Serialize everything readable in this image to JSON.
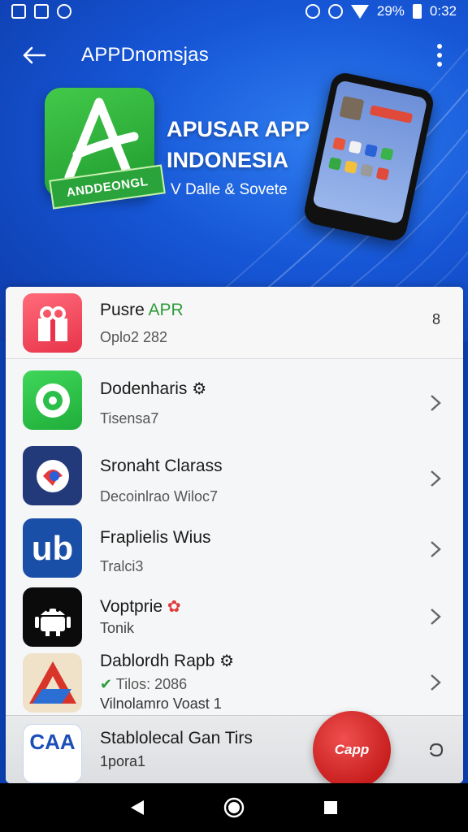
{
  "status_bar": {
    "battery_percent": "29%",
    "time": "0:32"
  },
  "app_bar": {
    "title": "APPDnomsjas"
  },
  "banner": {
    "logo_ribbon": "ANDDEONGL",
    "title_line1": "APUSAR APP",
    "title_line2": "INDONESIA",
    "subtitle": "V Dalle & Sovete"
  },
  "list": {
    "featured": {
      "title": "Pusre",
      "title_accent": "APR",
      "subtitle": "Oplo2 282",
      "counter": "8"
    },
    "items": [
      {
        "title": "Dodenharis",
        "subtitle": "Tisensa7",
        "icon": "green-target-icon"
      },
      {
        "title": "Sronaht Clarass",
        "subtitle": "Decoinlrao Wiloc7",
        "icon": "blue-chat-icon"
      },
      {
        "title": "Fraplielis Wius",
        "subtitle": "Tralci3",
        "icon": "ub-icon"
      },
      {
        "title": "Voptprie",
        "subtitle": "Tonik",
        "icon": "android-icon"
      },
      {
        "title": "Dablordh Rapb",
        "subtitle": "Tilos: 2086",
        "subtitle2": "Vilnolamro Voast 1",
        "icon": "red-triangle-icon"
      }
    ],
    "partial": {
      "title": "Stablolecal Gan Tirs",
      "subtitle": "1pora1",
      "icon_label": "CAA",
      "badge_label": "Capp"
    }
  },
  "colors": {
    "hero_blue": "#1656d6",
    "accent_green": "#2e9b3a",
    "badge_red": "#d12626"
  }
}
